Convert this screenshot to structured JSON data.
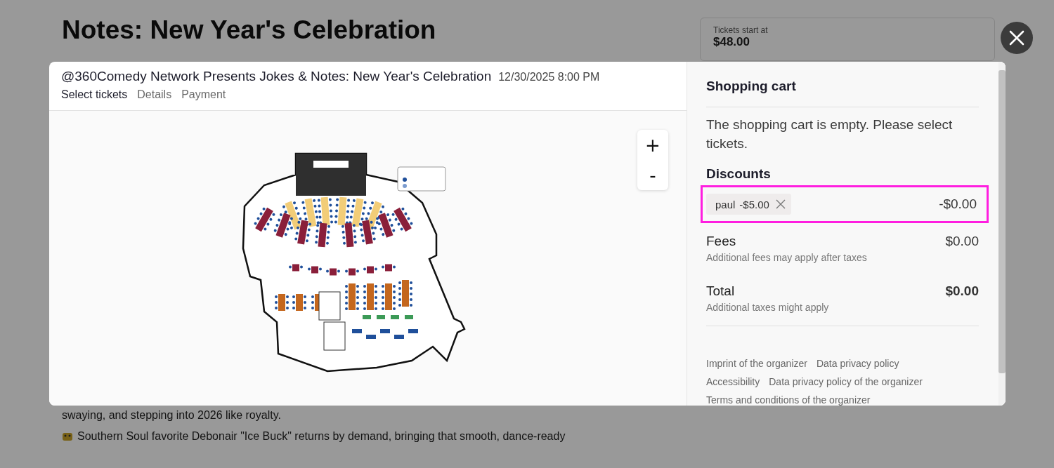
{
  "background_page": {
    "heading": "Notes: New Year's Celebration",
    "paragraphs": [
      "swaying, and stepping into 2026 like royalty.",
      "Southern Soul favorite Debonair \"Ice Buck\" returns by demand, bringing that smooth, dance-ready"
    ],
    "price_card": {
      "label": "Tickets start at",
      "price": "$48.00"
    }
  },
  "modal": {
    "title": "@360Comedy Network Presents Jokes & Notes: New Year's Celebration",
    "date": "12/30/2025 8:00 PM",
    "steps": [
      {
        "label": "Select tickets",
        "selected": true
      },
      {
        "label": "Details",
        "selected": false
      },
      {
        "label": "Payment",
        "selected": false
      }
    ],
    "zoom_controls": [
      "+",
      "-"
    ],
    "seat_map": {
      "kind": "picture"
    },
    "cart": {
      "title": "Shopping cart",
      "empty_message": "The shopping cart is empty. Please select tickets.",
      "discounts": {
        "title": "Discounts",
        "highlighted": true,
        "items": [
          {
            "code": "paul",
            "value": "-$5.00",
            "amount": "-$0.00"
          }
        ]
      },
      "fees": {
        "label": "Fees",
        "amount": "$0.00",
        "note": "Additional fees may apply after taxes"
      },
      "total": {
        "label": "Total",
        "amount": "$0.00",
        "note": "Additional taxes might apply"
      },
      "links": [
        "Imprint of the organizer",
        "Data privacy policy",
        "Accessibility",
        "Data privacy policy of the organizer",
        "Terms and conditions of the organizer"
      ]
    }
  }
}
